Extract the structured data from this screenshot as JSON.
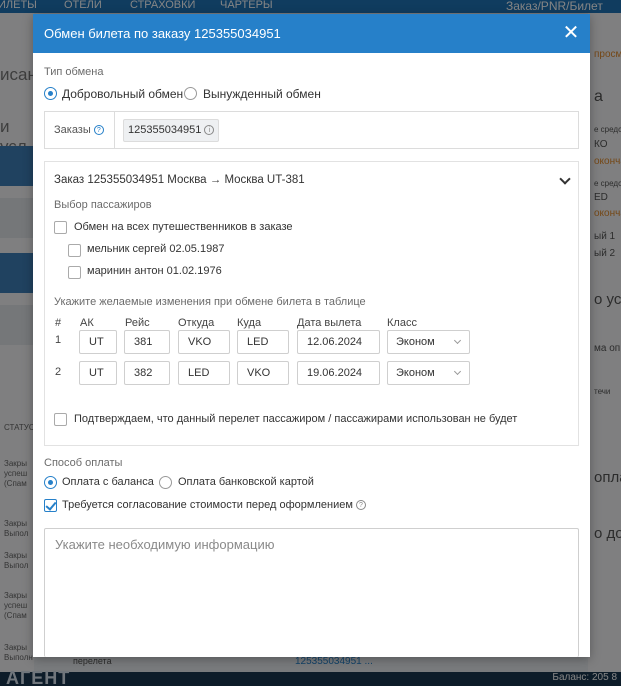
{
  "background": {
    "topbar": [
      "ИЛЕТЫ",
      "ОТЕЛИ",
      "СТРАХОВКИ",
      "ЧАРТЕРЫ",
      "Заказ/PNR/Билет"
    ],
    "left_big": [
      "исан",
      "и усл"
    ],
    "left_rows": [
      [
        "Закры",
        "успеш",
        "(Спам"
      ],
      [
        "Закры",
        "Выпол"
      ],
      [
        "Закры",
        "Выпол"
      ],
      [
        "Закры",
        "успеш",
        "(Спам"
      ],
      [
        "Закры",
        "Выполн"
      ]
    ],
    "left_status": "СТАТУС",
    "right_texts": [
      "просм",
      "а",
      "е средс",
      "КО",
      "оконча",
      "е средс",
      "ED",
      "оконча",
      "ый 1",
      "ый 2",
      "о уст",
      "ма оп",
      "течи",
      "оплат",
      "о до"
    ],
    "bottom_logo": "АГЕНТ",
    "bottom_balance": "Баланс:  205 8",
    "bottom_mid": "перелета",
    "bottom_order": "125355034951 ..."
  },
  "modal": {
    "title": "Обмен билета по заказу 125355034951",
    "exchange_type": {
      "label": "Тип обмена",
      "voluntary": "Добровольный обмен",
      "forced": "Вынужденный обмен",
      "selected": "voluntary"
    },
    "orders": {
      "label": "Заказы",
      "tag": "125355034951"
    },
    "order_panel": {
      "header": "Заказ 125355034951 Москва → Москва UT-381",
      "passenger_label": "Выбор пассажиров",
      "all_passengers": "Обмен на всех путешественников в заказе",
      "passengers": [
        "мельник сергей 02.05.1987",
        "маринин антон 01.02.1976"
      ],
      "changes_label": "Укажите желаемые изменения при обмене билета в таблице",
      "columns": [
        "#",
        "АК",
        "Рейс",
        "Откуда",
        "Куда",
        "Дата вылета",
        "Класс"
      ],
      "rows": [
        {
          "num": "1",
          "ak": "UT",
          "flight": "381",
          "from": "VKO",
          "to": "LED",
          "date": "12.06.2024",
          "class": "Эконом"
        },
        {
          "num": "2",
          "ak": "UT",
          "flight": "382",
          "from": "LED",
          "to": "VKO",
          "date": "19.06.2024",
          "class": "Эконом"
        }
      ],
      "confirm": "Подтверждаем, что данный перелет пассажиром / пассажирами использован не будет"
    },
    "payment": {
      "label": "Способ оплаты",
      "balance": "Оплата с баланса",
      "card": "Оплата банковской картой",
      "selected": "balance",
      "approval": "Требуется согласование стоимости перед оформлением"
    },
    "info_placeholder": "Укажите необходимую информацию"
  },
  "colors": {
    "header": "#2680c9",
    "accent": "#2680c9",
    "bottombar": "#1a3650"
  }
}
